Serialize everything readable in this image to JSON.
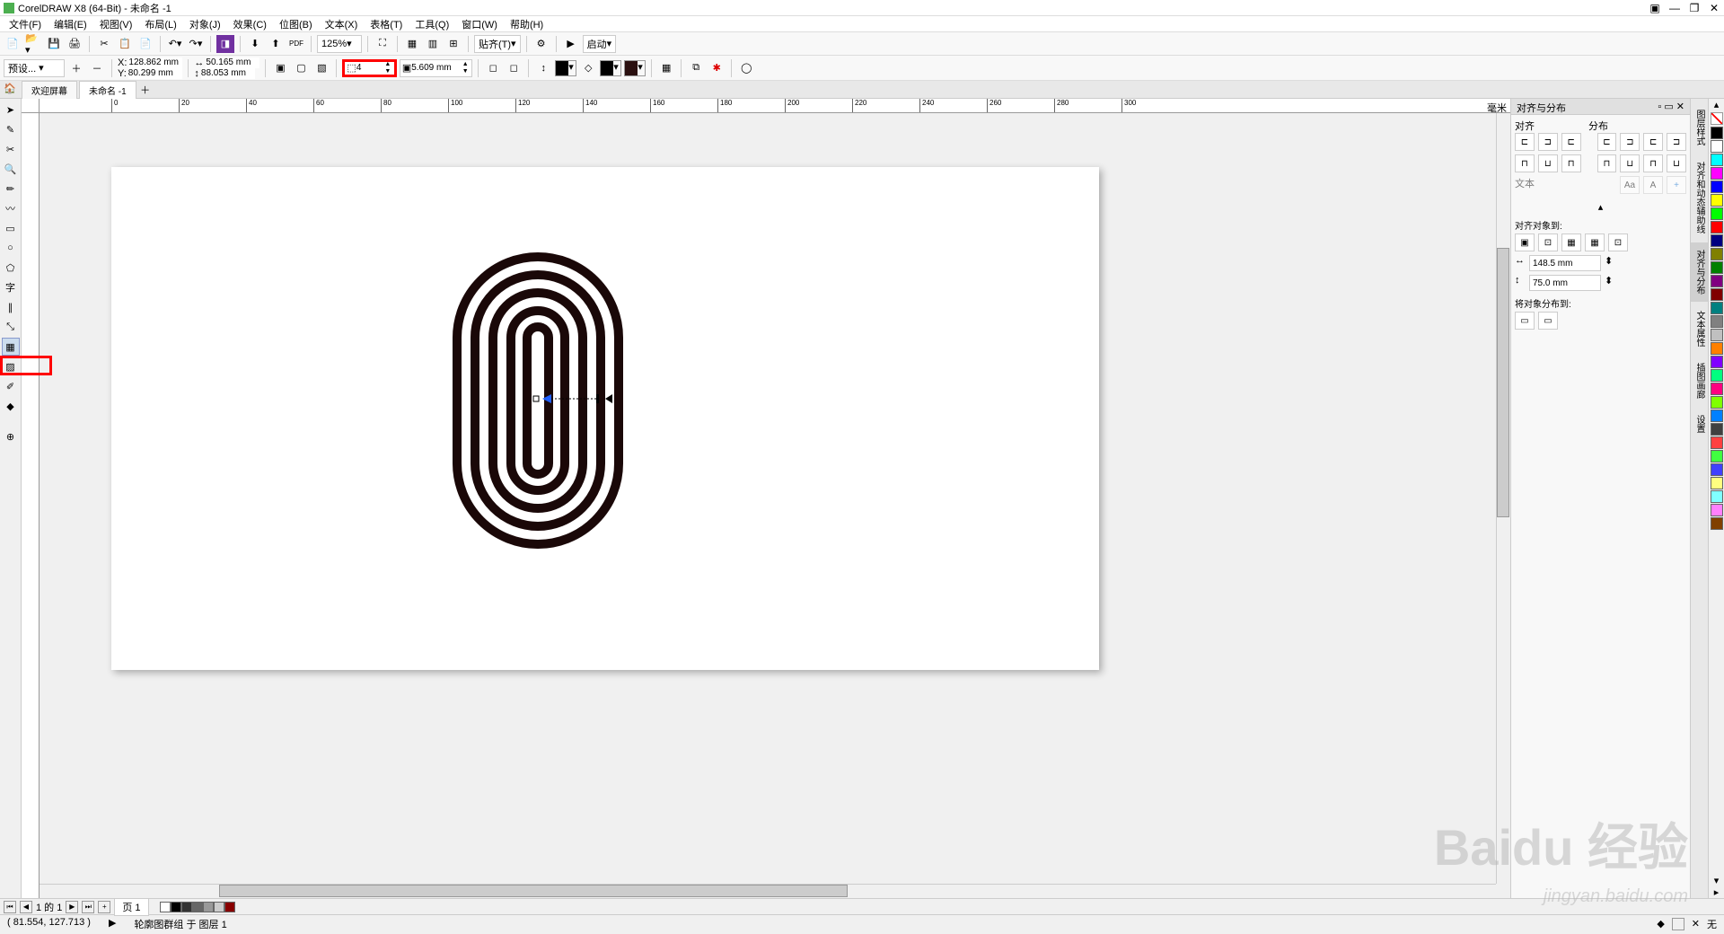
{
  "title": "CorelDRAW X8 (64-Bit) - 未命名 -1",
  "menu": [
    "文件(F)",
    "编辑(E)",
    "视图(V)",
    "布局(L)",
    "对象(J)",
    "效果(C)",
    "位图(B)",
    "文本(X)",
    "表格(T)",
    "工具(Q)",
    "窗口(W)",
    "帮助(H)"
  ],
  "toolbar": {
    "zoom": "125%",
    "snap": "贴齐(T)",
    "launch": "启动"
  },
  "propbar": {
    "preset": "预设...",
    "x": "128.862 mm",
    "y": "80.299 mm",
    "w": "50.165 mm",
    "h": "88.053 mm",
    "contour_steps": "4",
    "offset": "5.609 mm"
  },
  "tabs": {
    "welcome": "欢迎屏幕",
    "doc": "未命名 -1"
  },
  "ruler_unit": "毫米",
  "docker": {
    "title": "对齐与分布",
    "align": "对齐",
    "distribute": "分布",
    "text": "文本",
    "align_to": "对齐对象到:",
    "val1": "148.5 mm",
    "val2": "75.0 mm",
    "distribute_to": "将对象分布到:"
  },
  "docker_tabs": [
    "图层样式",
    "对齐和动态辅助线",
    "对齐与分布",
    "文本属性",
    "插图画廊",
    "设置"
  ],
  "pagebar": {
    "text": "1 的 1",
    "page": "页 1"
  },
  "status": {
    "coords": "( 81.554, 127.713 )",
    "selection": "轮廓图群组 于 图层 1",
    "fill_none": "无"
  },
  "watermark": "Baidu 经验",
  "watermark_sub": "jingyan.baidu.com",
  "palette": [
    "#000000",
    "#ffffff",
    "#00ffff",
    "#ff00ff",
    "#0000ff",
    "#ffff00",
    "#00ff00",
    "#ff0000",
    "#000080",
    "#808000",
    "#008000",
    "#800080",
    "#800000",
    "#008080",
    "#808080",
    "#c0c0c0",
    "#ff8000",
    "#8000ff",
    "#00ff80",
    "#ff0080",
    "#80ff00",
    "#0080ff",
    "#404040",
    "#ff4040",
    "#40ff40",
    "#4040ff",
    "#ffff80",
    "#80ffff",
    "#ff80ff",
    "#804000"
  ]
}
